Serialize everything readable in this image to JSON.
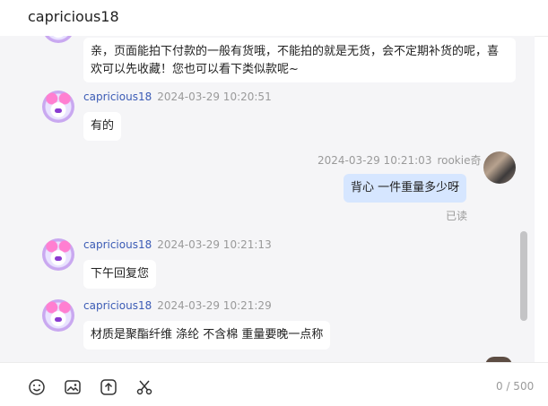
{
  "header": {
    "title": "capricious18"
  },
  "messages": [
    {
      "text": "亲，页面能拍下付款的一般有货哦，不能拍的就是无货，会不定期补货的呢，喜欢可以先收藏！您也可以看下类似款呢~"
    },
    {
      "sender": "capricious18",
      "time": "2024-03-29 10:20:51",
      "text": "有的"
    },
    {
      "sender": "rookie奇",
      "time": "2024-03-29 10:21:03",
      "text": "背心 一件重量多少呀",
      "status": "已读"
    },
    {
      "sender": "capricious18",
      "time": "2024-03-29 10:21:13",
      "text": "下午回复您"
    },
    {
      "sender": "capricious18",
      "time": "2024-03-29 10:21:29",
      "text": "材质是聚酯纤维 涤纶 不含棉 重量要晚一点称"
    }
  ],
  "toolbar": {
    "icons": [
      "emoji-icon",
      "image-icon",
      "upload-icon",
      "scissors-icon"
    ],
    "counter": "0 / 500"
  },
  "colors": {
    "agent_name": "#3b5bb5",
    "customer_bubble": "#d6e6ff",
    "chat_background": "#f5f5f7"
  }
}
